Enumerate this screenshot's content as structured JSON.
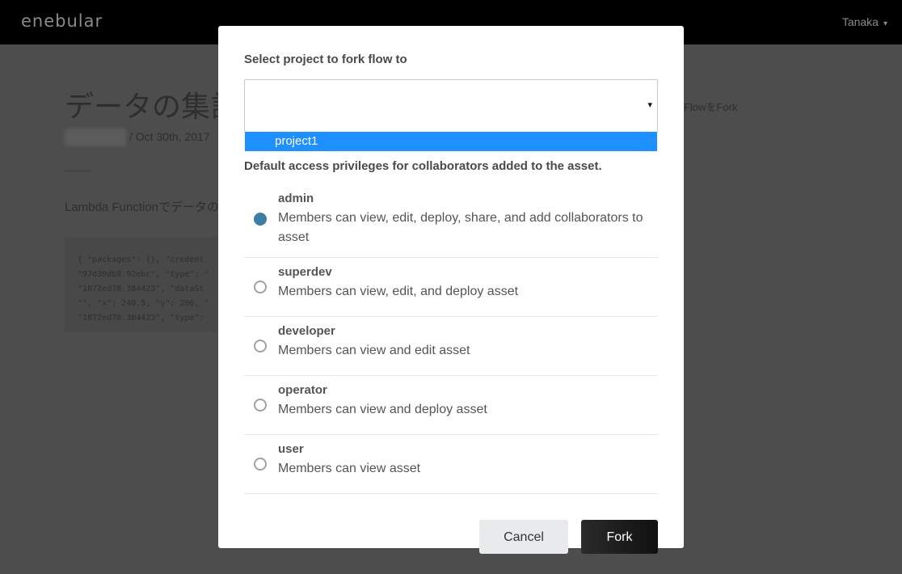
{
  "app": {
    "logo_text": "enebular",
    "user_name": "Tanaka",
    "user_caret": "▾"
  },
  "background_page": {
    "title": "データの集計",
    "date_text": "/ Oct 30th, 2017",
    "fork_link": "FlowをFork",
    "description": "Lambda Functionでデータの",
    "code_lines": [
      "{ \"packages\": {}, \"credent",
      "\"97d39db8.92ebc\", \"type\": \"",
      "\"1872ed78.384423\", \"dataSt",
      "\"\", \"x\": 240.5, \"y\": 206, \"",
      "\"1872ed78.384423\", \"type\":"
    ]
  },
  "modal": {
    "select_label": "Select project to fork flow to",
    "select_value": "",
    "select_caret": "▾",
    "dropdown_options": [
      "project1"
    ],
    "privileges_label": "Default access privileges for collaborators added to the asset.",
    "roles": [
      {
        "name": "admin",
        "description": "Members can view, edit, deploy, share, and add collaborators to asset",
        "selected": true
      },
      {
        "name": "superdev",
        "description": "Members can view, edit, and deploy asset",
        "selected": false
      },
      {
        "name": "developer",
        "description": "Members can view and edit asset",
        "selected": false
      },
      {
        "name": "operator",
        "description": "Members can view and deploy asset",
        "selected": false
      },
      {
        "name": "user",
        "description": "Members can view asset",
        "selected": false
      }
    ],
    "cancel_label": "Cancel",
    "fork_label": "Fork"
  },
  "colors": {
    "overlay": "#4a4a4a",
    "topbar": "#000000",
    "dropdown_highlight": "#1e90ff",
    "radio_selected": "#3c7ea6",
    "fork_button": "#1b1b1b",
    "cancel_button": "#e9eaec"
  }
}
